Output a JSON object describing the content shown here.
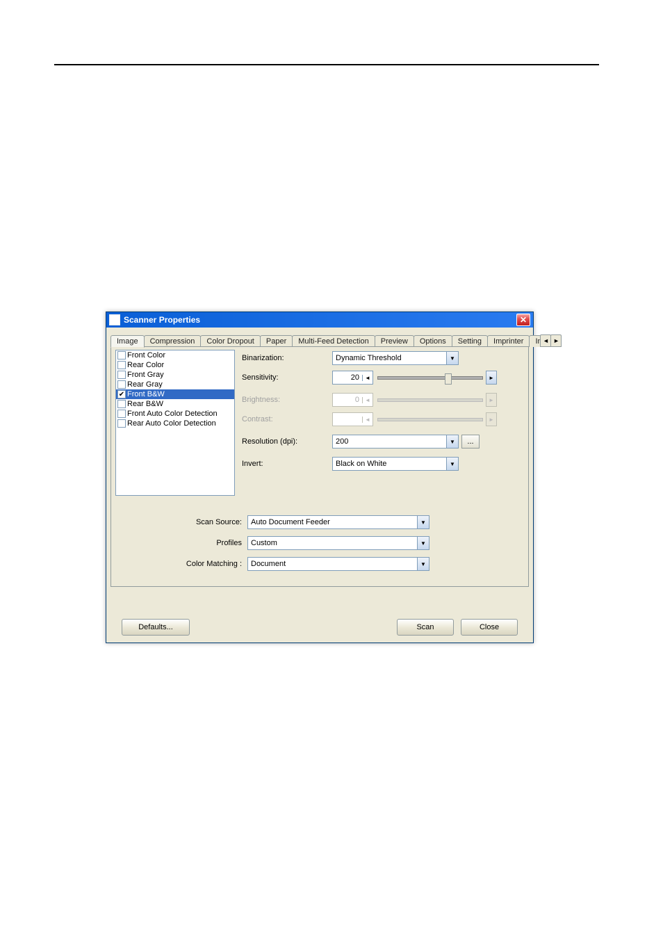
{
  "window": {
    "title": "Scanner Properties"
  },
  "tabs": {
    "image": "Image",
    "compression": "Compression",
    "color_dropout": "Color Dropout",
    "paper": "Paper",
    "multi_feed": "Multi-Feed Detection",
    "preview": "Preview",
    "options": "Options",
    "setting": "Setting",
    "imprinter": "Imprinter",
    "partial": "In"
  },
  "image_list": {
    "items": [
      {
        "label": "Front Color",
        "checked": false,
        "selected": false
      },
      {
        "label": "Rear Color",
        "checked": false,
        "selected": false
      },
      {
        "label": "Front Gray",
        "checked": false,
        "selected": false
      },
      {
        "label": "Rear Gray",
        "checked": false,
        "selected": false
      },
      {
        "label": "Front B&W",
        "checked": true,
        "selected": true
      },
      {
        "label": "Rear B&W",
        "checked": false,
        "selected": false
      },
      {
        "label": "Front Auto Color Detection",
        "checked": false,
        "selected": false
      },
      {
        "label": "Rear Auto Color Detection",
        "checked": false,
        "selected": false
      }
    ]
  },
  "controls": {
    "binarization": {
      "label": "Binarization:",
      "value": "Dynamic Threshold"
    },
    "sensitivity": {
      "label": "Sensitivity:",
      "value": "20"
    },
    "brightness": {
      "label": "Brightness:",
      "value": "0"
    },
    "contrast": {
      "label": "Contrast:",
      "value": ""
    },
    "resolution": {
      "label": "Resolution (dpi):",
      "value": "200",
      "more": "..."
    },
    "invert": {
      "label": "Invert:",
      "value": "Black on White"
    }
  },
  "mid": {
    "scan_source": {
      "label": "Scan Source:",
      "value": "Auto Document Feeder"
    },
    "profiles": {
      "label": "Profiles",
      "value": "Custom"
    },
    "color_matching": {
      "label": "Color Matching :",
      "value": "Document"
    }
  },
  "buttons": {
    "defaults": "Defaults...",
    "scan": "Scan",
    "close": "Close"
  },
  "glyphs": {
    "close_x": "✕",
    "left": "◄",
    "right": "►",
    "down": "▼",
    "check": "✔"
  }
}
